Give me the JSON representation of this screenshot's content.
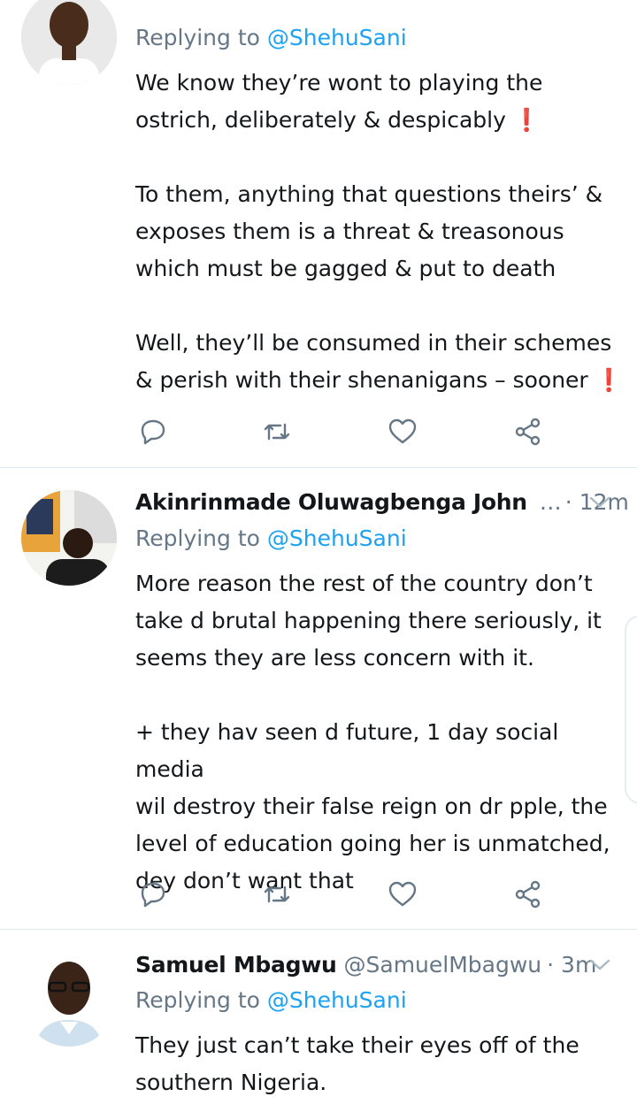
{
  "tweets": [
    {
      "reply_prefix": "Replying to ",
      "reply_to": "@ShehuSani",
      "text": "We know they’re wont to playing the\nostrich, deliberately & despicably ❗\n\nTo them, anything that questions theirs’ &\nexposes them is a threat & treasonous\nwhich must be gagged & put to death\n\nWell, they’ll be consumed in their schemes\n& perish with their shenanigans – sooner ❗"
    },
    {
      "name": "Akinrinmade Oluwagbenga John",
      "handle_truncated": "…",
      "time": "· 12m",
      "reply_prefix": "Replying to ",
      "reply_to": "@ShehuSani",
      "text": "More reason the rest of the country don’t\ntake d brutal happening there seriously, it\nseems they are less concern with it.\n\n+ they hav seen d future, 1 day social media\nwil destroy their false reign on dr pple, the\nlevel of education going her is unmatched,\ndey don’t want that"
    },
    {
      "name": "Samuel Mbagwu",
      "handle": "@SamuelMbagwu",
      "time": "· 3m",
      "reply_prefix": "Replying to ",
      "reply_to": "@ShehuSani",
      "text": "They just can’t take their eyes off of the\nsouthern Nigeria."
    }
  ],
  "icons": {
    "reply": "reply-icon",
    "retweet": "retweet-icon",
    "like": "heart-icon",
    "share": "share-icon",
    "menu": "chevron-down-icon"
  },
  "colors": {
    "text": "#14171a",
    "secondary": "#657786",
    "link": "#1da1f2",
    "divider": "#e1e8ed",
    "icon": "#657786"
  }
}
